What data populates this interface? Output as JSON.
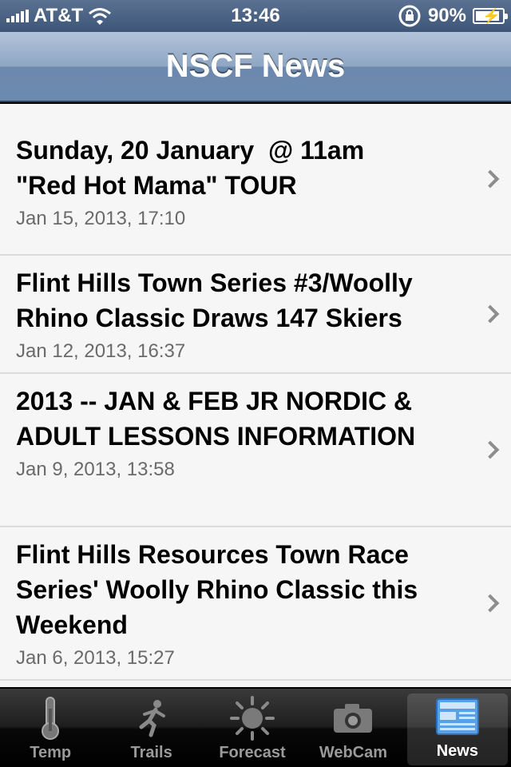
{
  "status_bar": {
    "carrier": "AT&T",
    "time": "13:46",
    "battery": "90%",
    "battery_level": 0.9
  },
  "nav": {
    "title": "NSCF News"
  },
  "news": [
    {
      "title": "Sunday, 20 January  @ 11am\n\"Red Hot Mama\" TOUR",
      "date": "Jan 15, 2013, 17:10"
    },
    {
      "title": "Flint Hills Town Series #3/Woolly Rhino Classic Draws 147 Skiers",
      "date": "Jan 12, 2013, 16:37"
    },
    {
      "title": "2013 -- JAN & FEB JR NORDIC & ADULT LESSONS INFORMATION",
      "date": "Jan 9, 2013, 13:58"
    },
    {
      "title": "Flint Hills Resources Town Race Series' Woolly Rhino Classic this Weekend",
      "date": "Jan 6, 2013, 15:27"
    }
  ],
  "tabs": [
    {
      "label": "Temp",
      "icon": "thermometer-icon"
    },
    {
      "label": "Trails",
      "icon": "skier-icon"
    },
    {
      "label": "Forecast",
      "icon": "sun-icon"
    },
    {
      "label": "WebCam",
      "icon": "camera-icon"
    },
    {
      "label": "News",
      "icon": "newspaper-icon",
      "active": true
    }
  ]
}
